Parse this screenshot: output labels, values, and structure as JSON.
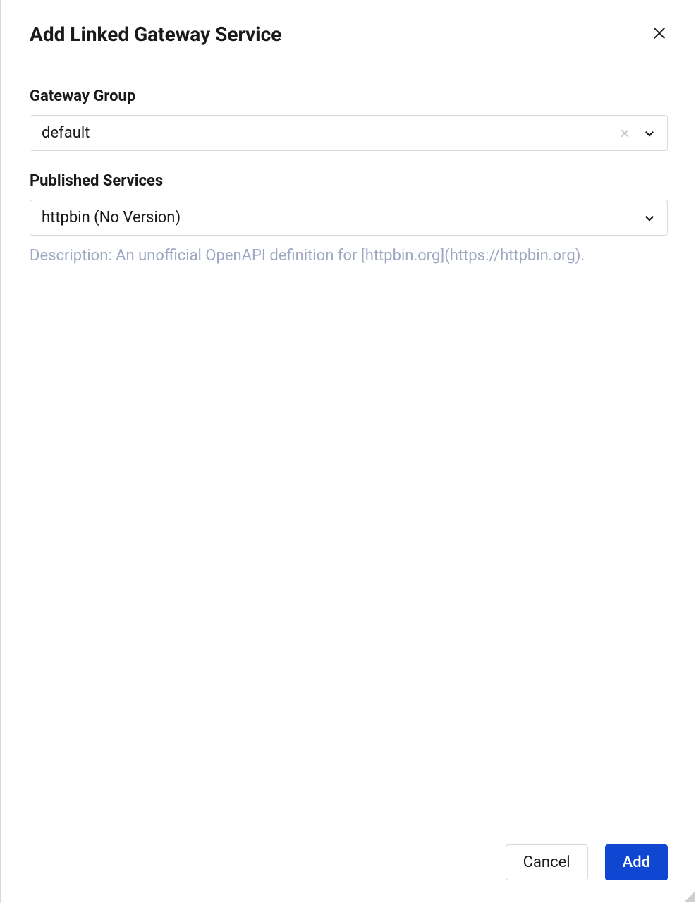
{
  "dialog": {
    "title": "Add Linked Gateway Service",
    "fields": {
      "gatewayGroup": {
        "label": "Gateway Group",
        "value": "default"
      },
      "publishedServices": {
        "label": "Published Services",
        "value": "httpbin (No Version)",
        "description": "Description: An unofficial OpenAPI definition for [httpbin.org](https://httpbin.org)."
      }
    },
    "footer": {
      "cancel": "Cancel",
      "add": "Add"
    }
  }
}
